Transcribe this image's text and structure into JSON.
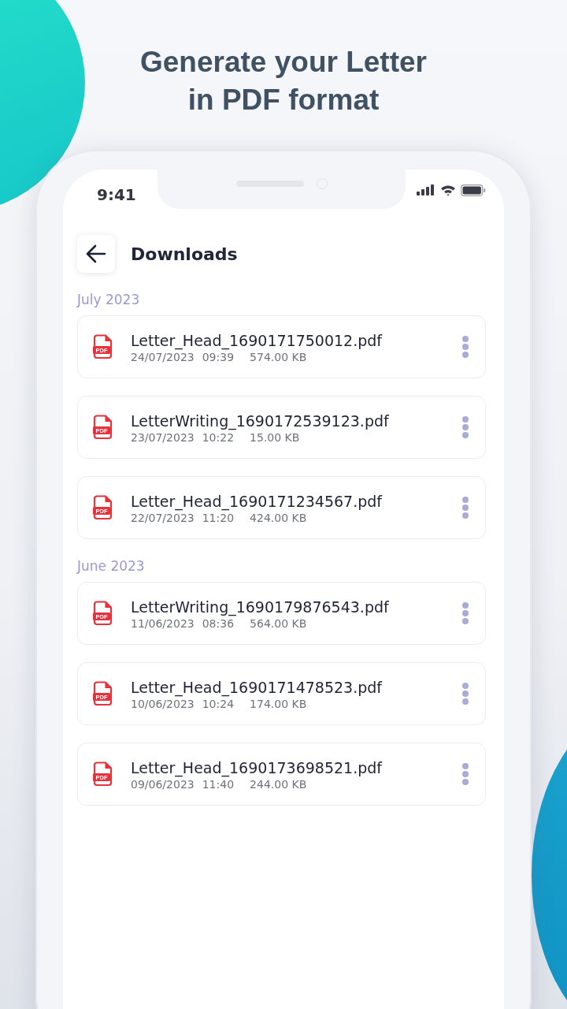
{
  "headline": [
    "Generate your Letter",
    "in PDF format"
  ],
  "status_bar": {
    "time": "9:41"
  },
  "header": {
    "title": "Downloads"
  },
  "sections": [
    {
      "label": "July 2023",
      "files": [
        {
          "badge": "PDF",
          "name": "Letter_Head_1690171750012.pdf",
          "date": "24/07/2023",
          "time": "09:39",
          "size": "574.00 KB"
        },
        {
          "badge": "PDF",
          "name": "LetterWriting_1690172539123.pdf",
          "date": "23/07/2023",
          "time": "10:22",
          "size": "15.00 KB"
        },
        {
          "badge": "PDF",
          "name": "Letter_Head_1690171234567.pdf",
          "date": "22/07/2023",
          "time": "11:20",
          "size": "424.00 KB"
        }
      ]
    },
    {
      "label": "June 2023",
      "files": [
        {
          "badge": "PDF",
          "name": "LetterWriting_1690179876543.pdf",
          "date": "11/06/2023",
          "time": "08:36",
          "size": "564.00 KB"
        },
        {
          "badge": "PDF",
          "name": "Letter_Head_1690171478523.pdf",
          "date": "10/06/2023",
          "time": "10:24",
          "size": "174.00 KB"
        },
        {
          "badge": "PDF",
          "name": "Letter_Head_1690173698521.pdf",
          "date": "09/06/2023",
          "time": "11:40",
          "size": "244.00 KB"
        }
      ]
    }
  ]
}
